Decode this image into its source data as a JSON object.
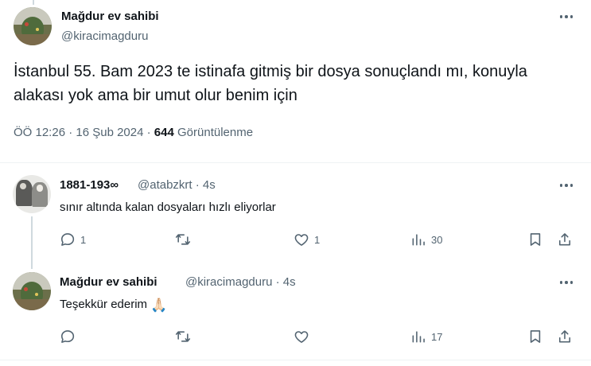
{
  "main_tweet": {
    "display_name": "Mağdur ev sahibi",
    "handle": "@kiracimagduru",
    "text": "İstanbul 55. Bam 2023 te istinafa gitmiş bir dosya sonuçlandı mı, konuyla alakası yok ama bir umut olur benim için",
    "timestamp": "ÖÖ 12:26 · 16 Şub 2024 ·",
    "views_count": "644",
    "views_label": "Görüntülenme"
  },
  "replies": [
    {
      "display_name": "1881-193∞",
      "handle": "@atabzkrt · 4s",
      "text": "sınır altında kalan dosyaları hızlı eliyorlar",
      "emoji": "",
      "reply_count": "1",
      "retweet_count": "",
      "like_count": "1",
      "views_count": "30"
    },
    {
      "display_name": "Mağdur ev sahibi",
      "handle": "@kiracimagduru · 4s",
      "text": "Teşekkür ederim",
      "emoji": "🙏🏻",
      "reply_count": "",
      "retweet_count": "",
      "like_count": "",
      "views_count": "17"
    }
  ],
  "icons": {
    "more": "more-horizontal-icon",
    "reply": "reply-icon",
    "retweet": "retweet-icon",
    "like": "heart-icon",
    "views": "views-bar-chart-icon",
    "bookmark": "bookmark-icon",
    "share": "share-icon"
  },
  "colors": {
    "text_primary": "#0f1419",
    "text_secondary": "#536471",
    "divider": "#eff3f4",
    "thread_line": "#cfd9de"
  }
}
